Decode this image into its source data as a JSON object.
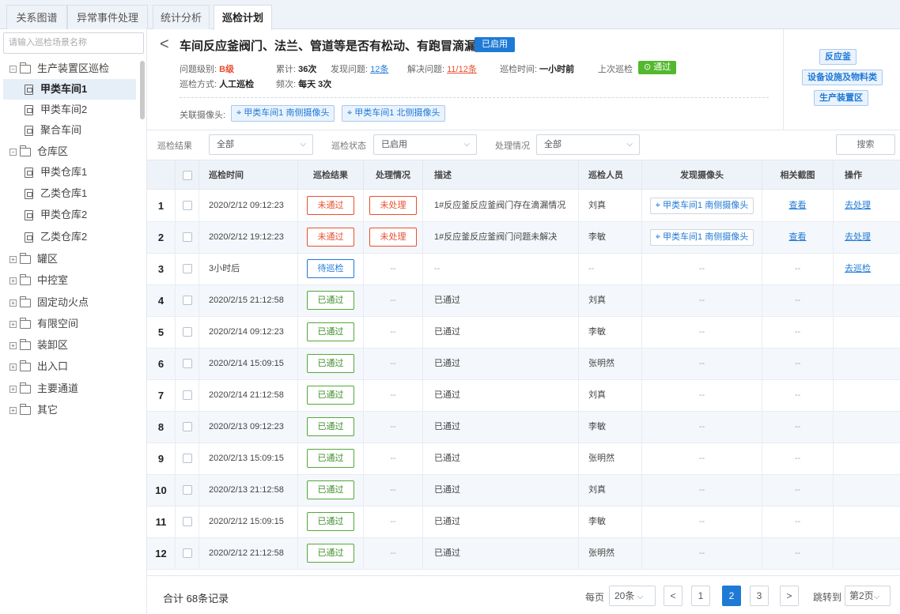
{
  "tabs": [
    "关系图谱",
    "异常事件处理",
    "统计分析",
    "巡检计划"
  ],
  "sidebar": {
    "search_placeholder": "请输入巡检场景名称",
    "items": [
      {
        "label": "生产装置区巡检",
        "toggle": "⊟"
      },
      {
        "label": "甲类车间1"
      },
      {
        "label": "甲类车间2"
      },
      {
        "label": "聚合车间"
      },
      {
        "label": "仓库区",
        "toggle": "⊟"
      },
      {
        "label": "甲类仓库1"
      },
      {
        "label": "乙类仓库1"
      },
      {
        "label": "甲类仓库2"
      },
      {
        "label": "乙类仓库2"
      },
      {
        "label": "罐区",
        "toggle": "⊞"
      },
      {
        "label": "中控室",
        "toggle": "⊞"
      },
      {
        "label": "固定动火点",
        "toggle": "⊞"
      },
      {
        "label": "有限空间",
        "toggle": "⊞"
      },
      {
        "label": "装卸区",
        "toggle": "⊞"
      },
      {
        "label": "出入口",
        "toggle": "⊞"
      },
      {
        "label": "主要通道",
        "toggle": "⊞"
      },
      {
        "label": "其它",
        "toggle": "⊞"
      }
    ]
  },
  "header": {
    "back": "<",
    "title": "车间反应釜阀门、法兰、管道等是否有松动、有跑冒滴漏",
    "status": "已启用",
    "level_label": "问题级别:",
    "level": "B级",
    "total_label": "累计:",
    "total": "36次",
    "found_label": "发现问题:",
    "found": "12条",
    "solved_label": "解决问题:",
    "solved": "11/12条",
    "time_label": "巡检时间:",
    "time": "一小时前",
    "last_label": "上次巡检",
    "last_result": "通过",
    "method_label": "巡检方式:",
    "method": "人工巡检",
    "freq_label": "频次:",
    "freq": "每天 3次",
    "camera_label": "关联摄像头:",
    "cameras": [
      "甲类车间1 南侧摄像头",
      "甲类车间1 北侧摄像头"
    ],
    "right_tags": [
      "反应釜",
      "设备设施及物料类",
      "生产装置区"
    ]
  },
  "filters": {
    "result_label": "巡检结果",
    "result_value": "全部",
    "status_label": "巡检状态",
    "status_value": "已启用",
    "handle_label": "处理情况",
    "handle_value": "全部",
    "search_btn": "搜索"
  },
  "table": {
    "columns": [
      "巡检时间",
      "巡检结果",
      "处理情况",
      "描述",
      "巡检人员",
      "发现摄像头",
      "相关截图",
      "操作"
    ],
    "rows": [
      {
        "no": "1",
        "time": "2020/2/12 09:12:23",
        "result": "未通过",
        "handle": "未处理",
        "desc": "1#反应釜反应釜阀门存在滴漏情况",
        "person": "刘真",
        "camera": "甲类车间1 南侧摄像头",
        "shot": "查看",
        "op": "去处理"
      },
      {
        "no": "2",
        "time": "2020/2/12 19:12:23",
        "result": "未通过",
        "handle": "未处理",
        "desc": "1#反应釜反应釜阀门问题未解决",
        "person": "李敏",
        "camera": "甲类车间1 南侧摄像头",
        "shot": "查看",
        "op": "去处理"
      },
      {
        "no": "3",
        "time": "3小时后",
        "result": "待巡检",
        "handle": "--",
        "desc": "--",
        "person": "--",
        "camera": "--",
        "shot": "--",
        "op": "去巡检"
      },
      {
        "no": "4",
        "time": "2020/2/15 21:12:58",
        "result": "已通过",
        "handle": "--",
        "desc": "已通过",
        "person": "刘真",
        "camera": "--",
        "shot": "--",
        "op": ""
      },
      {
        "no": "5",
        "time": "2020/2/14 09:12:23",
        "result": "已通过",
        "handle": "--",
        "desc": "已通过",
        "person": "李敏",
        "camera": "--",
        "shot": "--",
        "op": ""
      },
      {
        "no": "6",
        "time": "2020/2/14 15:09:15",
        "result": "已通过",
        "handle": "--",
        "desc": "已通过",
        "person": "张明然",
        "camera": "--",
        "shot": "--",
        "op": ""
      },
      {
        "no": "7",
        "time": "2020/2/14 21:12:58",
        "result": "已通过",
        "handle": "--",
        "desc": "已通过",
        "person": "刘真",
        "camera": "--",
        "shot": "--",
        "op": ""
      },
      {
        "no": "8",
        "time": "2020/2/13 09:12:23",
        "result": "已通过",
        "handle": "--",
        "desc": "已通过",
        "person": "李敏",
        "camera": "--",
        "shot": "--",
        "op": ""
      },
      {
        "no": "9",
        "time": "2020/2/13 15:09:15",
        "result": "已通过",
        "handle": "--",
        "desc": "已通过",
        "person": "张明然",
        "camera": "--",
        "shot": "--",
        "op": ""
      },
      {
        "no": "10",
        "time": "2020/2/13 21:12:58",
        "result": "已通过",
        "handle": "--",
        "desc": "已通过",
        "person": "刘真",
        "camera": "--",
        "shot": "--",
        "op": ""
      },
      {
        "no": "11",
        "time": "2020/2/12 15:09:15",
        "result": "已通过",
        "handle": "--",
        "desc": "已通过",
        "person": "李敏",
        "camera": "--",
        "shot": "--",
        "op": ""
      },
      {
        "no": "12",
        "time": "2020/2/12 21:12:58",
        "result": "已通过",
        "handle": "--",
        "desc": "已通过",
        "person": "张明然",
        "camera": "--",
        "shot": "--",
        "op": ""
      }
    ]
  },
  "footer": {
    "total": "合计 68条记录",
    "per_page_label": "每页",
    "per_page": "20条",
    "prev": "<",
    "pages": [
      "1",
      "2",
      "3"
    ],
    "current_page": "2",
    "next": ">",
    "goto_label": "跳转到",
    "goto_value": "第2页"
  },
  "colors": {
    "primary": "#1f7ad6",
    "fail": "#e8502f",
    "pass": "#53b82e"
  }
}
